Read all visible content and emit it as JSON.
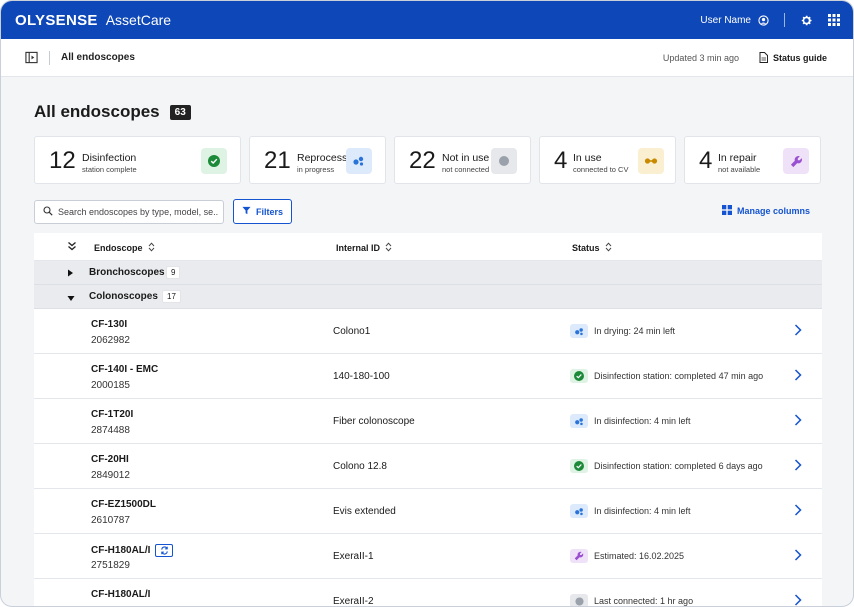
{
  "header": {
    "brand": "OLYSENSE",
    "app_name": "AssetCare",
    "user_name": "User Name"
  },
  "subheader": {
    "breadcrumb": "All endoscopes",
    "updated": "Updated 3 min ago",
    "status_guide": "Status guide"
  },
  "page": {
    "title": "All endoscopes",
    "total_count": "63"
  },
  "cards": [
    {
      "count": "12",
      "title": "Disinfection",
      "subtitle": "station complete",
      "icon": "check-circle-icon",
      "color": "#1d8a3a",
      "bg": "#dff3e4"
    },
    {
      "count": "21",
      "title": "Reprocessing",
      "subtitle": "in progress",
      "icon": "bubbles-icon",
      "color": "#2a73d8",
      "bg": "#dceafb"
    },
    {
      "count": "22",
      "title": "Not in use",
      "subtitle": "not connected",
      "icon": "grey-dot-icon",
      "color": "#9aa1ab",
      "bg": "#e6e8eb"
    },
    {
      "count": "4",
      "title": "In use",
      "subtitle": "connected to CV",
      "icon": "link-icon",
      "color": "#c98a00",
      "bg": "#fbefd2"
    },
    {
      "count": "4",
      "title": "In repair",
      "subtitle": "not available",
      "icon": "wrench-icon",
      "color": "#9b4fd1",
      "bg": "#efe2f8"
    }
  ],
  "toolbar": {
    "search_placeholder": "Search endoscopes by type, model, se...",
    "filters_label": "Filters",
    "manage_columns_label": "Manage columns"
  },
  "table": {
    "columns": [
      "Endoscope",
      "Internal ID",
      "Status"
    ],
    "groups": [
      {
        "name": "Bronchoscopes",
        "count": "9",
        "expanded": false
      },
      {
        "name": "Colonoscopes",
        "count": "17",
        "expanded": true
      }
    ],
    "rows": [
      {
        "model": "CF-130I",
        "serial": "2062982",
        "internal_id": "Colono1",
        "status": "In drying: 24 min left",
        "status_icon": "bubbles-icon",
        "status_color": "#2a73d8",
        "status_bg": "#dceafb",
        "sync": false
      },
      {
        "model": "CF-140I - EMC",
        "serial": "2000185",
        "internal_id": "140-180-100",
        "status": "Disinfection station: completed 47 min ago",
        "status_icon": "check-circle-icon",
        "status_color": "#1d8a3a",
        "status_bg": "#dff3e4",
        "sync": false
      },
      {
        "model": "CF-1T20I",
        "serial": "2874488",
        "internal_id": "Fiber colonoscope",
        "status": "In disinfection: 4 min left",
        "status_icon": "bubbles-icon",
        "status_color": "#2a73d8",
        "status_bg": "#dceafb",
        "sync": false
      },
      {
        "model": "CF-20HI",
        "serial": "2849012",
        "internal_id": "Colono 12.8",
        "status": "Disinfection station: completed 6 days ago",
        "status_icon": "check-circle-icon",
        "status_color": "#1d8a3a",
        "status_bg": "#dff3e4",
        "sync": false
      },
      {
        "model": "CF-EZ1500DL",
        "serial": "2610787",
        "internal_id": "Evis extended",
        "status": "In disinfection: 4 min left",
        "status_icon": "bubbles-icon",
        "status_color": "#2a73d8",
        "status_bg": "#dceafb",
        "sync": false
      },
      {
        "model": "CF-H180AL/I",
        "serial": "2751829",
        "internal_id": "ExeraII-1",
        "status": "Estimated: 16.02.2025",
        "status_icon": "wrench-icon",
        "status_color": "#9b4fd1",
        "status_bg": "#efe2f8",
        "sync": true
      },
      {
        "model": "CF-H180AL/I",
        "serial": "",
        "internal_id": "ExeraII-2",
        "status": "Last connected: 1 hr ago",
        "status_icon": "grey-dot-icon",
        "status_color": "#9aa1ab",
        "status_bg": "#e6e8eb",
        "sync": false
      }
    ]
  }
}
